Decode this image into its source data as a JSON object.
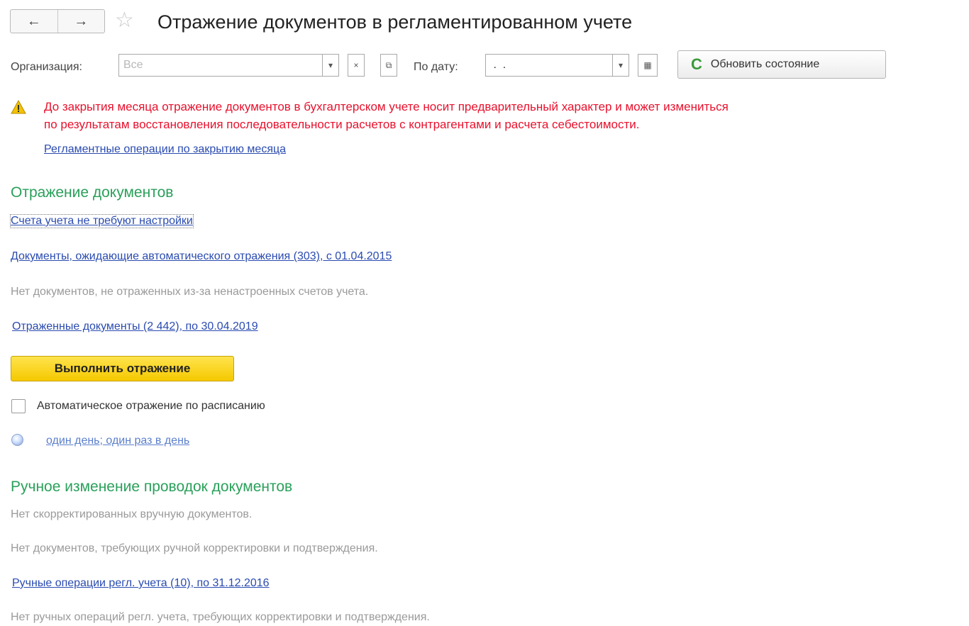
{
  "header": {
    "back_icon": "←",
    "forward_icon": "→",
    "star_icon": "☆",
    "title": "Отражение документов в регламентированном учете"
  },
  "filters": {
    "organization_label": "Организация:",
    "organization_placeholder": "Все",
    "organization_value": "",
    "dropdown_icon": "▾",
    "clear_icon": "×",
    "open_icon": "⧉",
    "date_label": "По дату:",
    "date_value": " .  .",
    "calendar_icon": "▦",
    "refresh_icon": "C",
    "refresh_label": "Обновить состояние"
  },
  "warning": {
    "line1": "До закрытия месяца отражение документов в бухгалтерском учете носит предварительный характер и может измениться",
    "line2": "по результатам восстановления последовательности расчетов с контрагентами и расчета себестоимости.",
    "link": "Регламентные операции по закрытию месяца",
    "color": "#e8112d"
  },
  "reflection": {
    "heading": "Отражение документов",
    "accounts_link": "Счета учета не требуют настройки",
    "pending_link": "Документы, ожидающие автоматического отражения (303), с 01.04.2015",
    "no_unreflected": "Нет документов, не отраженных из-за ненастроенных счетов учета.",
    "reflected_link": "Отраженные документы (2 442), по 30.04.2019",
    "execute_button": "Выполнить отражение",
    "auto_checkbox_label": "Автоматическое отражение по расписанию",
    "auto_checked": false,
    "schedule_link": "один день; один раз в день"
  },
  "manual": {
    "heading": "Ручное изменение проводок документов",
    "no_corrected": "Нет скорректированных вручную документов.",
    "no_needing_correction": "Нет документов, требующих ручной корректировки и подтверждения.",
    "manual_ops_link": "Ручные операции регл. учета (10), по 31.12.2016",
    "no_manual_ops": "Нет ручных операций регл. учета, требующих корректировки и подтверждения."
  },
  "colors": {
    "section_heading": "#2aa05a",
    "link": "#2a4bb0",
    "execute_button": "#f5c900"
  }
}
